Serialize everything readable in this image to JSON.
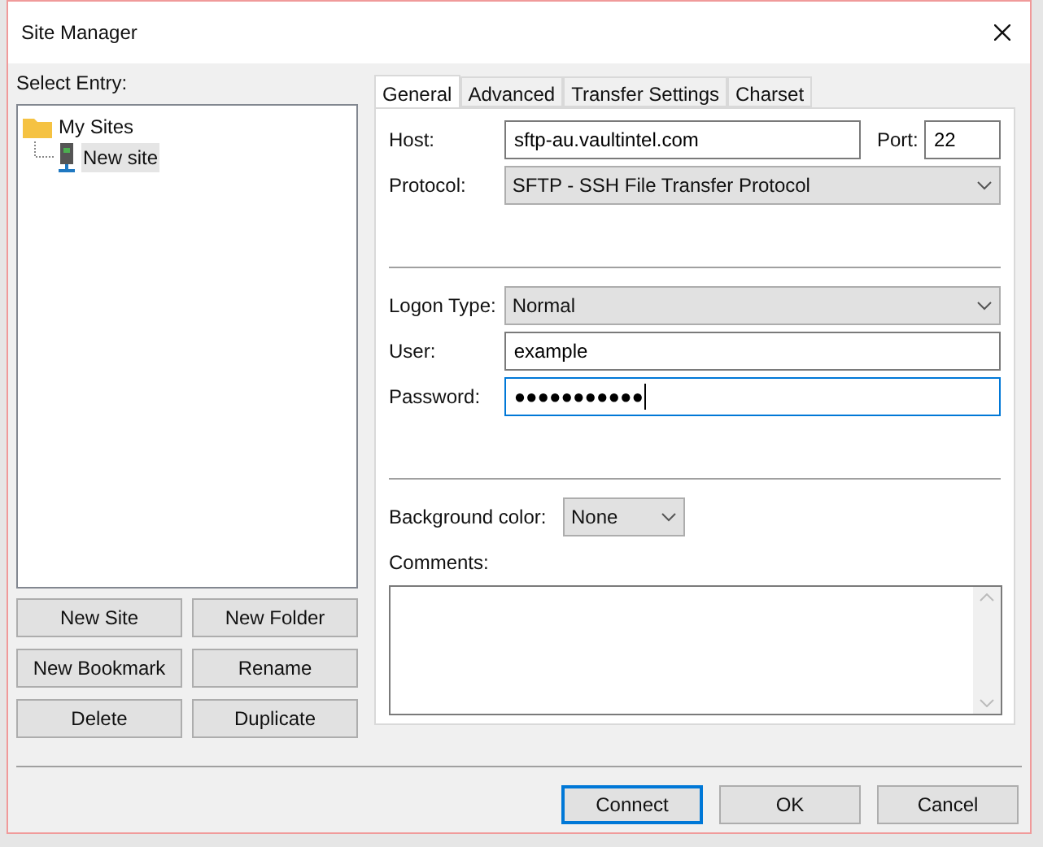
{
  "window": {
    "title": "Site Manager"
  },
  "select_entry_label": "Select Entry:",
  "tree": [
    {
      "label": "My Sites",
      "kind": "folder",
      "selected": false,
      "children": [
        {
          "label": "New site",
          "kind": "site",
          "selected": true
        }
      ]
    }
  ],
  "site_buttons": [
    "New Site",
    "New Folder",
    "New Bookmark",
    "Rename",
    "Delete",
    "Duplicate"
  ],
  "tabs": [
    {
      "label": "General",
      "selected": true
    },
    {
      "label": "Advanced",
      "selected": false
    },
    {
      "label": "Transfer Settings",
      "selected": false
    },
    {
      "label": "Charset",
      "selected": false
    }
  ],
  "host": {
    "label": "Host:",
    "value": "sftp-au.vaultintel.com"
  },
  "port": {
    "label": "Port:",
    "value": "22"
  },
  "protocol": {
    "label": "Protocol:",
    "value": "SFTP - SSH File Transfer Protocol"
  },
  "logon_type": {
    "label": "Logon Type:",
    "value": "Normal"
  },
  "user": {
    "label": "User:",
    "value": "example"
  },
  "password": {
    "label": "Password:",
    "value": "●●●●●●●●●●●",
    "focused": true
  },
  "background_color": {
    "label": "Background color:",
    "value": "None"
  },
  "comments": {
    "label": "Comments:"
  },
  "buttons": [
    {
      "label": "Connect",
      "default": true
    },
    {
      "label": "OK",
      "default": false
    },
    {
      "label": "Cancel",
      "default": false
    }
  ]
}
